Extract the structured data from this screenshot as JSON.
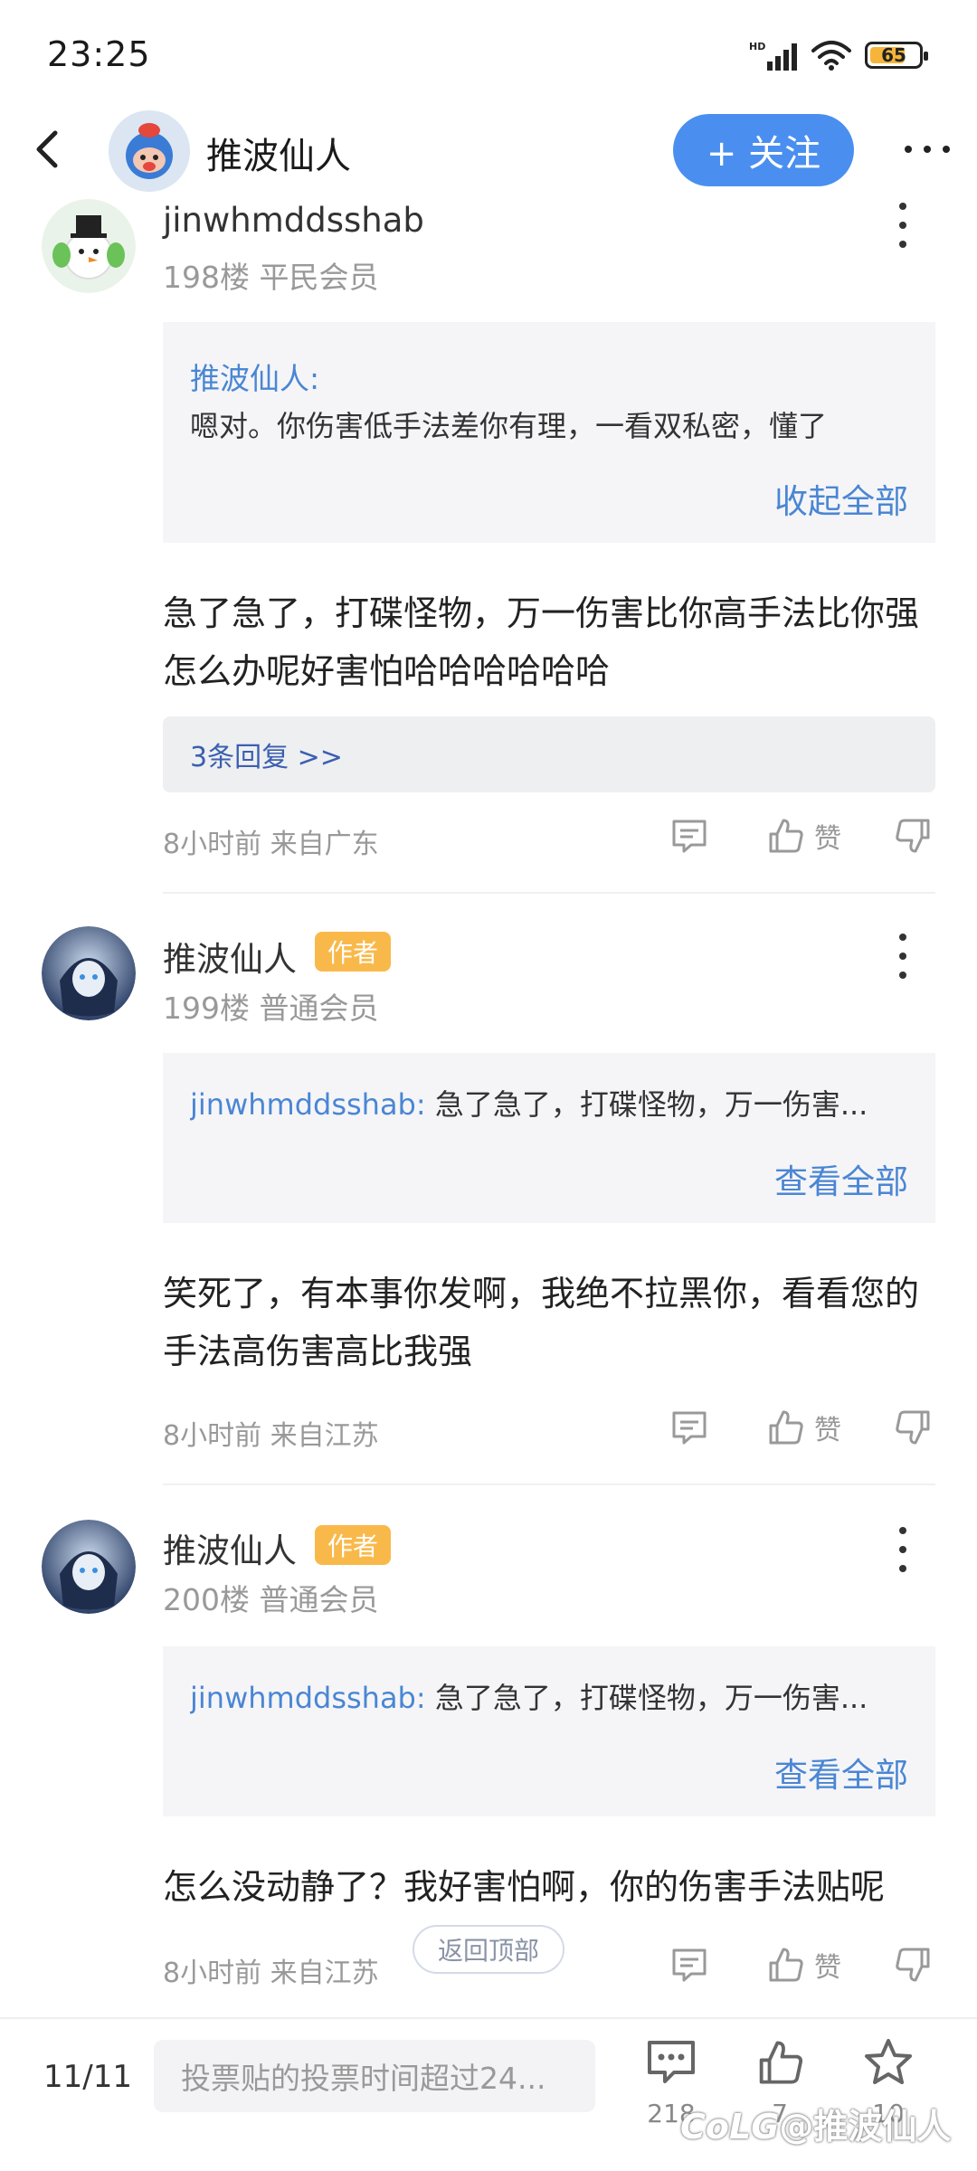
{
  "status_bar": {
    "time": "23:25",
    "battery": "65"
  },
  "header": {
    "title": "推波仙人",
    "follow_label": "+ 关注"
  },
  "posts": [
    {
      "username": "jinwhmddsshab",
      "floor": "198楼 平民会员",
      "quote": {
        "name": "推波仙人:",
        "text": "嗯对。你伤害低手法差你有理，一看双私密，懂了",
        "action": "收起全部"
      },
      "body": "急了急了，打碟怪物，万一伤害比你高手法比你强怎么办呢好害怕哈哈哈哈哈哈",
      "replies": "3条回复 >>",
      "meta": "8小时前 来自广东",
      "like_label": "赞"
    },
    {
      "username": "推波仙人",
      "badge": "作者",
      "floor": "199楼 普通会员",
      "quote": {
        "name": "jinwhmddsshab:",
        "text": " 急了急了，打碟怪物，万一伤害...",
        "action": "查看全部"
      },
      "body": "笑死了，有本事你发啊，我绝不拉黑你，看看您的手法高伤害高比我强",
      "meta": "8小时前 来自江苏",
      "like_label": "赞"
    },
    {
      "username": "推波仙人",
      "badge": "作者",
      "floor": "200楼 普通会员",
      "quote": {
        "name": "jinwhmddsshab:",
        "text": " 急了急了，打碟怪物，万一伤害...",
        "action": "查看全部"
      },
      "body": "怎么没动静了？我好害怕啊，你的伤害手法贴呢",
      "meta": "8小时前 来自江苏",
      "like_label": "赞"
    }
  ],
  "back_to_top": "返回顶部",
  "bottom_bar": {
    "page": "11/11",
    "input_placeholder": "投票贴的投票时间超过24...",
    "comment_count": "218",
    "like_count": "7",
    "star_count": "10"
  },
  "watermark": "@推波仙人",
  "colors": {
    "accent": "#4a8ff0",
    "link": "#4a86d4",
    "badge": "#f9b94a"
  }
}
